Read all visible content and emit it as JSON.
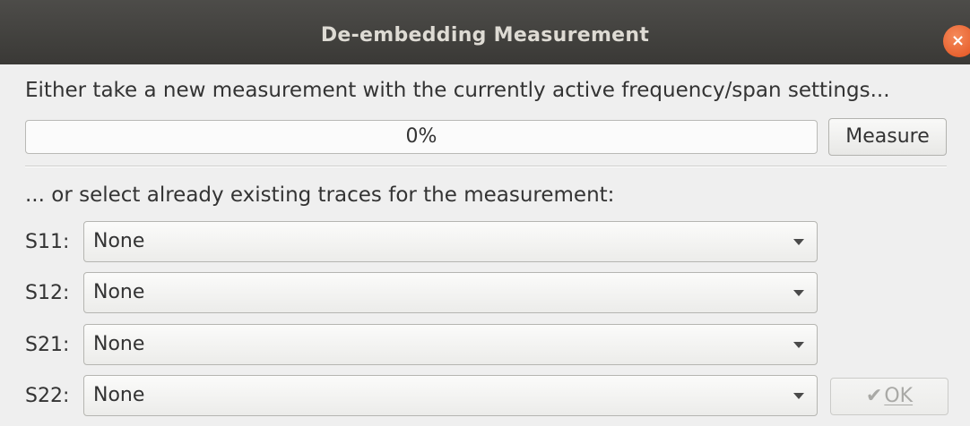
{
  "window": {
    "title": "De-embedding Measurement",
    "close_glyph": "×"
  },
  "measure": {
    "prompt": "Either take a new measurement with the currently active frequency/span settings...",
    "progress_text": "0%",
    "progress_value": 0,
    "button_label": "Measure"
  },
  "traces": {
    "prompt": "... or select already existing traces for the measurement:",
    "rows": [
      {
        "label": "S11:",
        "value": "None"
      },
      {
        "label": "S12:",
        "value": "None"
      },
      {
        "label": "S21:",
        "value": "None"
      },
      {
        "label": "S22:",
        "value": "None"
      }
    ]
  },
  "footer": {
    "ok_label": "OK",
    "ok_icon": "checkmark-icon",
    "ok_enabled": false
  },
  "colors": {
    "titlebar": "#3c3b37",
    "close_button": "#e95420",
    "accent": "#e95420"
  }
}
